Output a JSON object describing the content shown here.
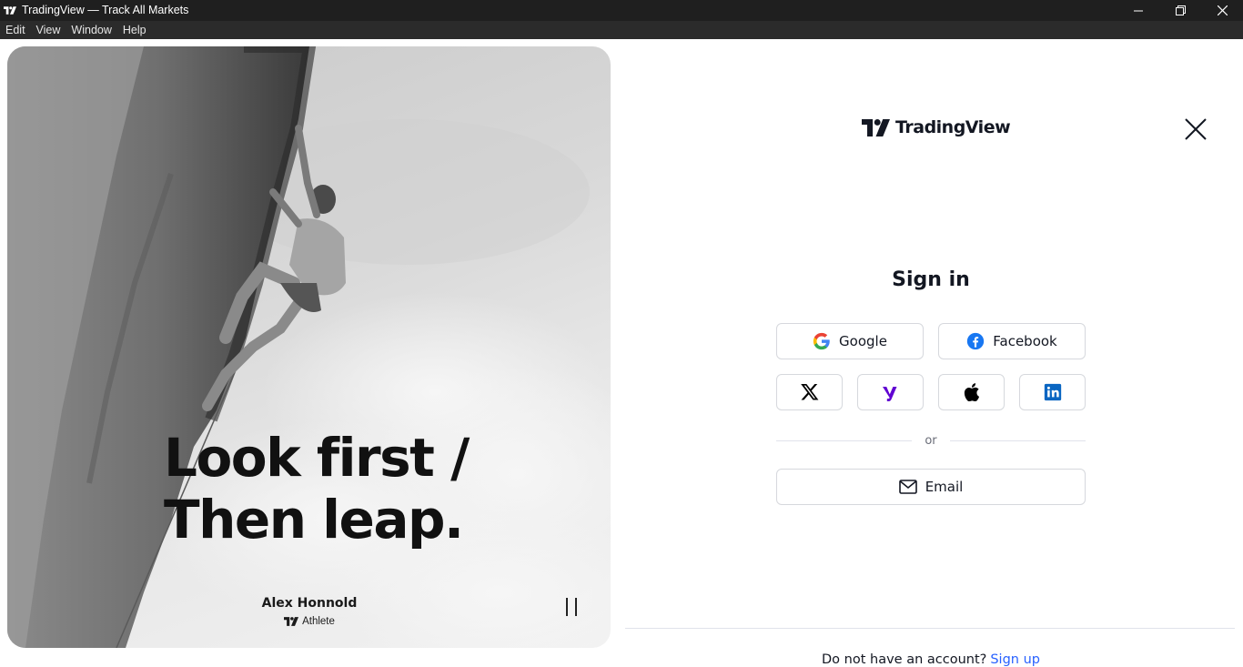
{
  "window": {
    "title": "TradingView — Track All Markets",
    "controls": [
      "minimize-icon",
      "restore-icon",
      "close-icon"
    ]
  },
  "menu": {
    "items": [
      "Edit",
      "View",
      "Window",
      "Help"
    ]
  },
  "hero": {
    "headline_line1": "Look first /",
    "headline_line2": "Then leap.",
    "athlete_name": "Alex Honnold",
    "athlete_role": "Athlete",
    "pause_icon": "pause-icon"
  },
  "signin": {
    "logo_text": "TradingView",
    "title": "Sign in",
    "google_label": "Google",
    "facebook_label": "Facebook",
    "social_icons": [
      "x-icon",
      "yahoo-icon",
      "apple-icon",
      "linkedin-icon"
    ],
    "divider_text": "or",
    "email_label": "Email",
    "footer_text": "Do not have an account?",
    "footer_link": "Sign up"
  },
  "colors": {
    "titlebar": "#1f1f1f",
    "menubar": "#2b2b2b",
    "link": "#2962ff",
    "facebook": "#1877f2",
    "yahoo": "#6001d2",
    "linkedin": "#0a66c2"
  }
}
